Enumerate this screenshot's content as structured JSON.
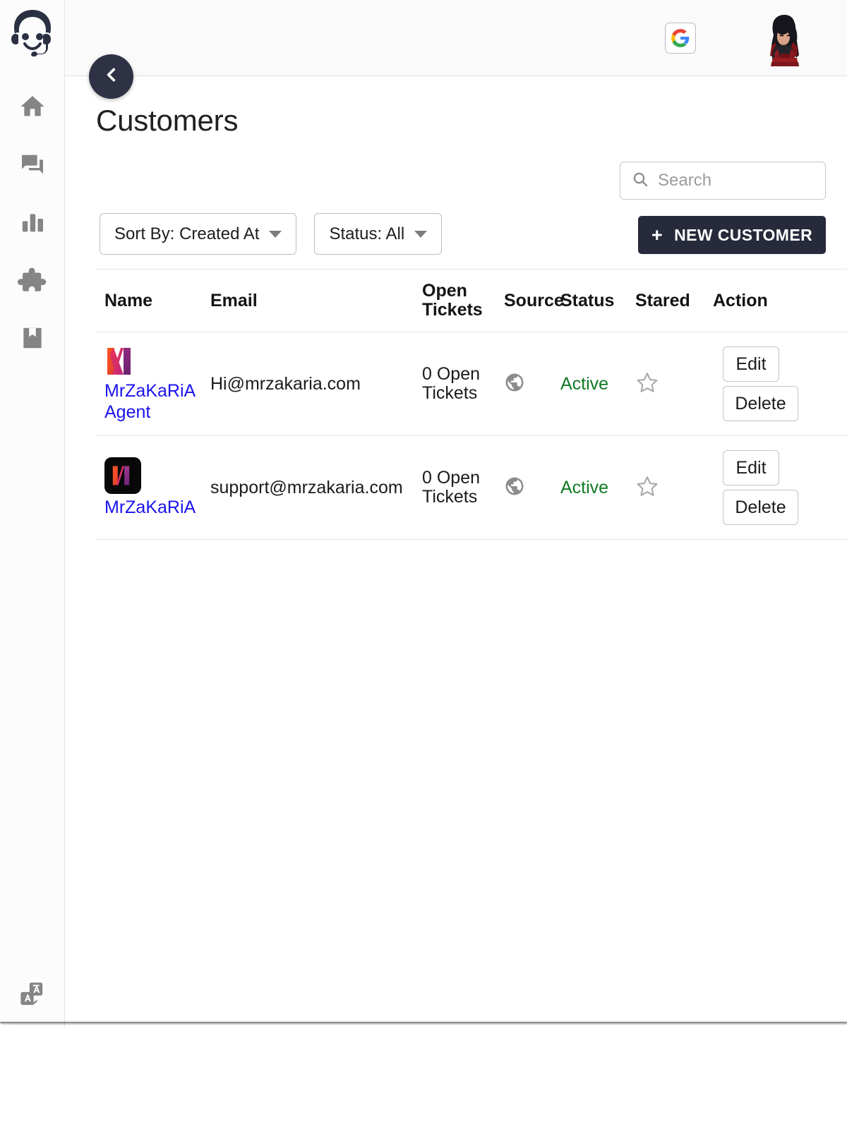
{
  "sidebar": {
    "brand_icon": "headset-agent-logo",
    "items": [
      {
        "icon": "home-icon",
        "name": "home"
      },
      {
        "icon": "chat-icon",
        "name": "conversations"
      },
      {
        "icon": "bar-chart-icon",
        "name": "reports"
      },
      {
        "icon": "puzzle-icon",
        "name": "integrations"
      },
      {
        "icon": "bookmark-icon",
        "name": "knowledge-base"
      }
    ],
    "bottom": {
      "icon": "translate-icon",
      "name": "translate"
    }
  },
  "topbar": {
    "google_icon": "google-icon",
    "avatar_alt": "user-avatar"
  },
  "collapse": {
    "icon": "chevron-left-icon"
  },
  "page": {
    "title": "Customers"
  },
  "search": {
    "value": "",
    "placeholder": "Search",
    "icon": "search-icon"
  },
  "filters": [
    {
      "label": "Sort By: Created At",
      "name": "sort-by"
    },
    {
      "label": "Status: All",
      "name": "status-filter"
    }
  ],
  "new_customer": {
    "label": "NEW CUSTOMER",
    "plus": "+"
  },
  "table": {
    "headers": [
      "Name",
      "Email",
      "Open Tickets",
      "Source",
      "Status",
      "Stared",
      "Action"
    ],
    "header_open_line1": "Open",
    "header_open_line2": "Tickets",
    "rows": [
      {
        "logo": "mrzakaria-logo-plain",
        "name": "MrZaKaRiA Agent",
        "email": "Hi@mrzakaria.com",
        "open_tickets_line1": "0 Open",
        "open_tickets_line2": "Tickets",
        "source": "globe-icon",
        "status": "Active",
        "stared": "star-outline-icon",
        "edit_label": "Edit",
        "delete_label": "Delete"
      },
      {
        "logo": "mrzakaria-logo-black",
        "name": "MrZaKaRiA",
        "email": "support@mrzakaria.com",
        "open_tickets_line1": "0 Open",
        "open_tickets_line2": "Tickets",
        "source": "globe-icon",
        "status": "Active",
        "stared": "star-outline-icon",
        "edit_label": "Edit",
        "delete_label": "Delete"
      }
    ]
  },
  "colors": {
    "accent_dark": "#262a3a",
    "link_blue": "#1a12ee",
    "status_green": "#117a24",
    "icon_grey": "#8c8c8c"
  }
}
